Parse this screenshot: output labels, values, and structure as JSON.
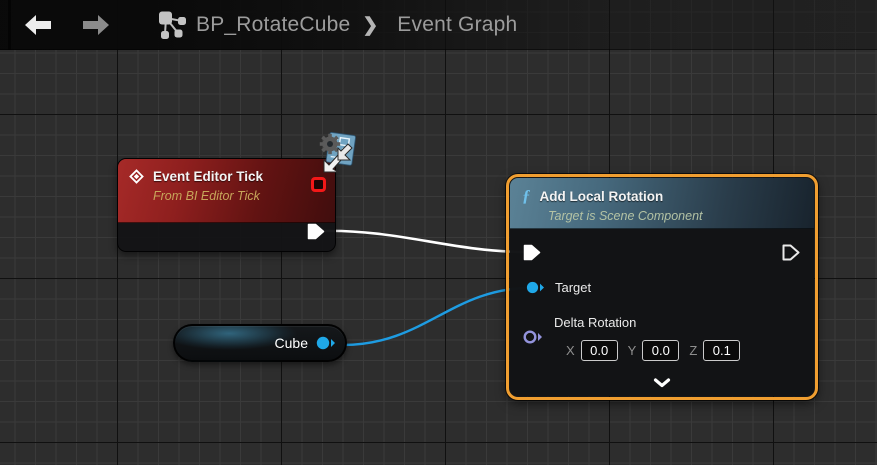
{
  "toolbar": {
    "breadcrumb": {
      "blueprint_name": "BP_RotateCube",
      "separator": "❯",
      "page": "Event Graph"
    }
  },
  "graph": {
    "event_node": {
      "title": "Event Editor Tick",
      "subtitle": "From BI Editor Tick"
    },
    "function_node": {
      "fn_icon": "ƒ",
      "title": "Add Local Rotation",
      "subtitle": "Target is Scene Component",
      "pins": {
        "target_label": "Target",
        "delta_label": "Delta Rotation",
        "x_label": "X",
        "x_value": "0.0",
        "y_label": "Y",
        "y_value": "0.0",
        "z_label": "Z",
        "z_value": "0.1"
      }
    },
    "variable_node": {
      "label": "Cube"
    }
  },
  "colors": {
    "selection_orange": "#F09E30",
    "exec_wire_white": "#FFFFFF",
    "object_pin_blue": "#1FA8E8",
    "rotator_pin_purple": "#9393DC",
    "delegate_pin_red": "#F21818",
    "event_header_red": "#8E1F1E",
    "function_header_blue": "#46697D",
    "grid_background": "#2D2D2D"
  }
}
